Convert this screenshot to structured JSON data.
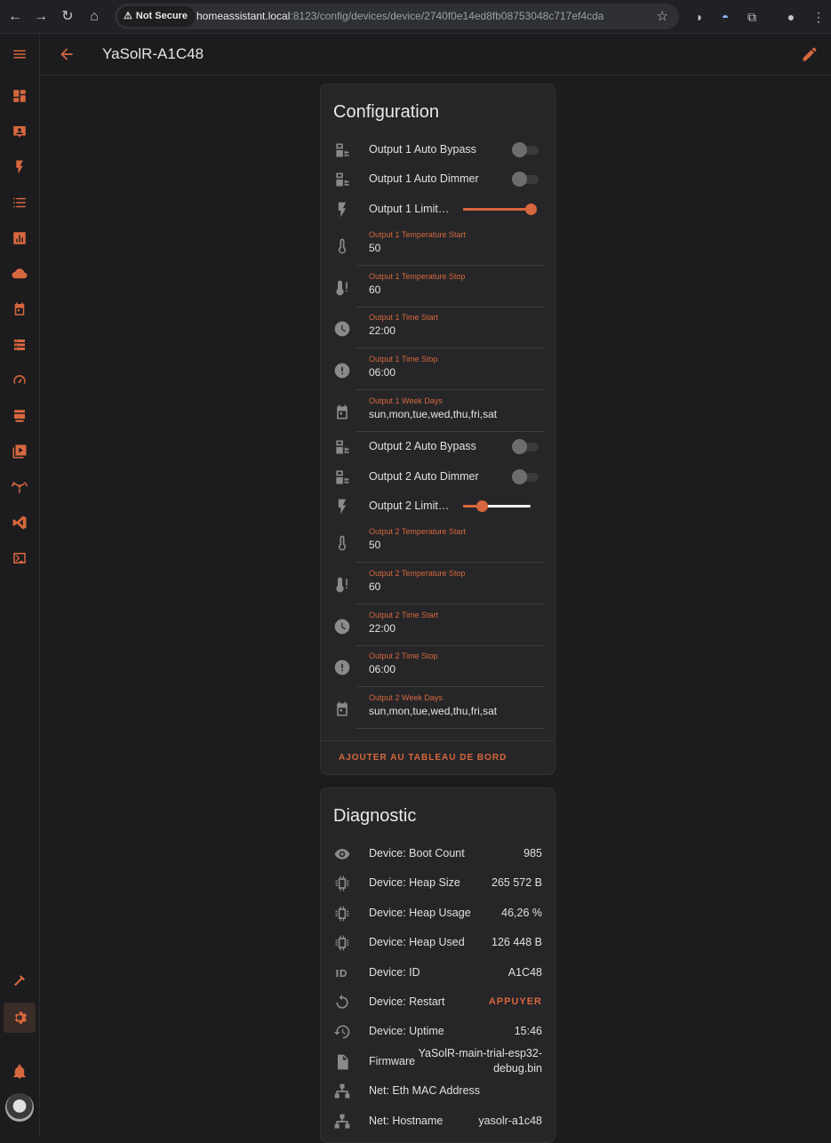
{
  "browser": {
    "security_label": "Not Secure",
    "url_host": "homeassistant.local",
    "url_rest": ":8123/config/devices/device/2740f0e14ed8fb08753048c717ef4cda"
  },
  "header": {
    "title": "YaSolR-A1C48"
  },
  "configuration": {
    "title": "Configuration",
    "rows": [
      {
        "kind": "switch",
        "icon": "transfer-icon",
        "label": "Output 1 Auto Bypass",
        "state": "off"
      },
      {
        "kind": "switch",
        "icon": "transfer-icon",
        "label": "Output 1 Auto Dimmer",
        "state": "off"
      },
      {
        "kind": "slider",
        "icon": "flash-icon",
        "label": "Output 1 Limit…",
        "level": 1.0
      },
      {
        "kind": "field",
        "icon": "thermometer-icon",
        "label": "Output 1 Temperature Start",
        "value": "50"
      },
      {
        "kind": "field",
        "icon": "thermometer-alert-icon",
        "label": "Output 1 Temperature Stop",
        "value": "60"
      },
      {
        "kind": "field",
        "icon": "clock-icon",
        "label": "Output 1 Time Start",
        "value": "22:00"
      },
      {
        "kind": "field",
        "icon": "clock-alert-icon",
        "label": "Output 1 Time Stop",
        "value": "06:00"
      },
      {
        "kind": "field",
        "icon": "calendar-icon",
        "label": "Output 1 Week Days",
        "value": "sun,mon,tue,wed,thu,fri,sat"
      },
      {
        "kind": "switch",
        "icon": "transfer-icon",
        "label": "Output 2 Auto Bypass",
        "state": "off"
      },
      {
        "kind": "switch",
        "icon": "transfer-icon",
        "label": "Output 2 Auto Dimmer",
        "state": "off"
      },
      {
        "kind": "slider",
        "icon": "flash-icon",
        "label": "Output 2 Limit…",
        "level": 0.28
      },
      {
        "kind": "field",
        "icon": "thermometer-icon",
        "label": "Output 2 Temperature Start",
        "value": "50"
      },
      {
        "kind": "field",
        "icon": "thermometer-alert-icon",
        "label": "Output 2 Temperature Stop",
        "value": "60"
      },
      {
        "kind": "field",
        "icon": "clock-icon",
        "label": "Output 2 Time Start",
        "value": "22:00"
      },
      {
        "kind": "field",
        "icon": "clock-alert-icon",
        "label": "Output 2 Time Stop",
        "value": "06:00"
      },
      {
        "kind": "field",
        "icon": "calendar-icon",
        "label": "Output 2 Week Days",
        "value": "sun,mon,tue,wed,thu,fri,sat"
      }
    ],
    "action_label": "AJOUTER AU TABLEAU DE BORD"
  },
  "diagnostic": {
    "title": "Diagnostic",
    "rows": [
      {
        "icon": "eye-icon",
        "label": "Device: Boot Count",
        "value": "985"
      },
      {
        "icon": "chip-icon",
        "label": "Device: Heap Size",
        "value": "265 572 B"
      },
      {
        "icon": "chip-icon",
        "label": "Device: Heap Usage",
        "value": "46,26 %"
      },
      {
        "icon": "chip-icon",
        "label": "Device: Heap Used",
        "value": "126 448 B"
      },
      {
        "icon": "id-icon",
        "label": "Device: ID",
        "value": "A1C48"
      },
      {
        "icon": "restart-icon",
        "label": "Device: Restart",
        "action": "APPUYER"
      },
      {
        "icon": "history-icon",
        "label": "Device: Uptime",
        "value": "15:46"
      },
      {
        "icon": "file-icon",
        "label": "Firmware",
        "value": "YaSolR-main-trial-esp32-debug.bin"
      },
      {
        "icon": "network-icon",
        "label": "Net: Eth MAC Address",
        "value": ""
      },
      {
        "icon": "network-icon",
        "label": "Net: Hostname",
        "value": "yasolr-a1c48"
      }
    ]
  },
  "sidebar": {
    "items": [
      {
        "icon": "menu-icon"
      },
      {
        "icon": "dashboard-icon"
      },
      {
        "icon": "account-box-icon"
      },
      {
        "icon": "flash-icon"
      },
      {
        "icon": "list-icon"
      },
      {
        "icon": "chart-icon"
      },
      {
        "icon": "cloud-icon"
      },
      {
        "icon": "calendar-icon"
      },
      {
        "icon": "server-icon"
      },
      {
        "icon": "speedometer-icon"
      },
      {
        "icon": "hacs-icon"
      },
      {
        "icon": "media-icon"
      },
      {
        "icon": "broadcast-icon"
      },
      {
        "icon": "vscode-icon"
      },
      {
        "icon": "terminal-icon"
      },
      {
        "icon": "hammer-icon"
      },
      {
        "icon": "settings-icon"
      },
      {
        "icon": "bell-icon"
      }
    ]
  },
  "accent_color": "#d7673e"
}
